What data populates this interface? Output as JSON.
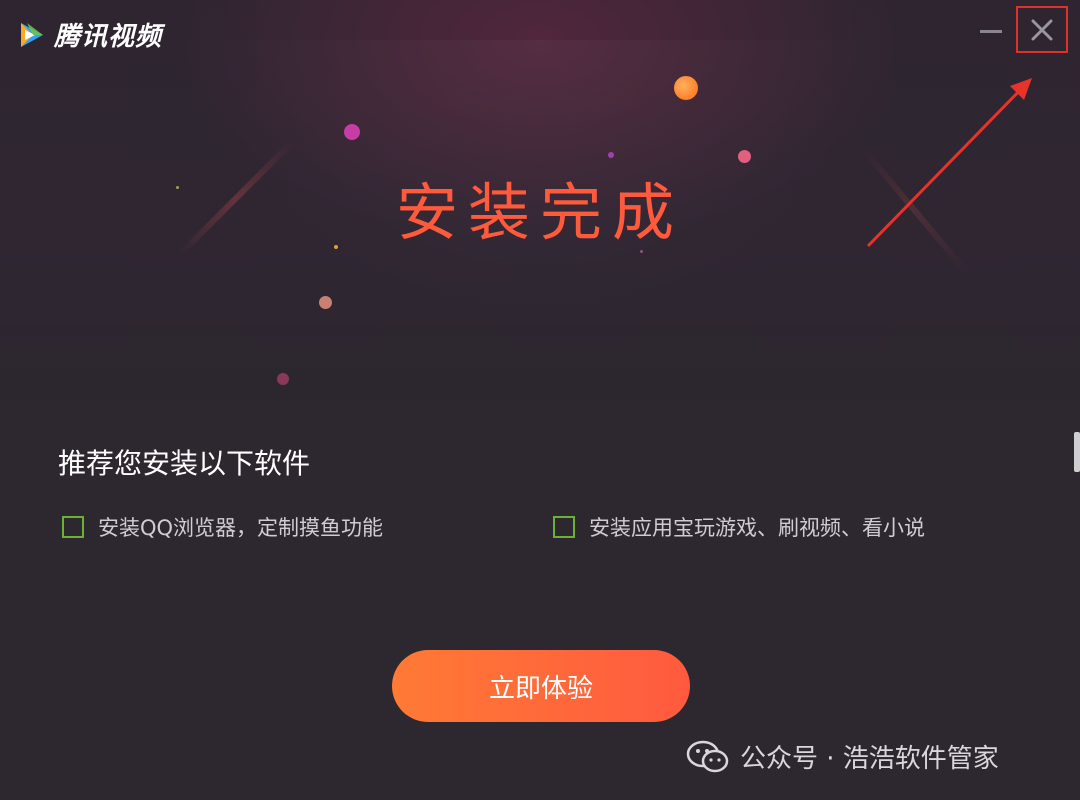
{
  "app": {
    "name": "腾讯视频",
    "brand_color": "#ff5a3c",
    "logo_icon": "tencent-video-play-icon"
  },
  "window_controls": {
    "minimize_icon": "minimize-icon",
    "close_icon": "close-icon",
    "close_highlight_color": "#e0302a"
  },
  "hero": {
    "headline": "安装完成"
  },
  "recommendations": {
    "title": "推荐您安装以下软件",
    "options": [
      {
        "label": "安装QQ浏览器，定制摸鱼功能",
        "checked": false
      },
      {
        "label": "安装应用宝玩游戏、刷视频、看小说",
        "checked": false
      }
    ],
    "checkbox_color": "#6bb134"
  },
  "cta": {
    "label": "立即体验"
  },
  "watermark": {
    "icon": "wechat-icon",
    "text": "公众号 · 浩浩软件管家"
  }
}
